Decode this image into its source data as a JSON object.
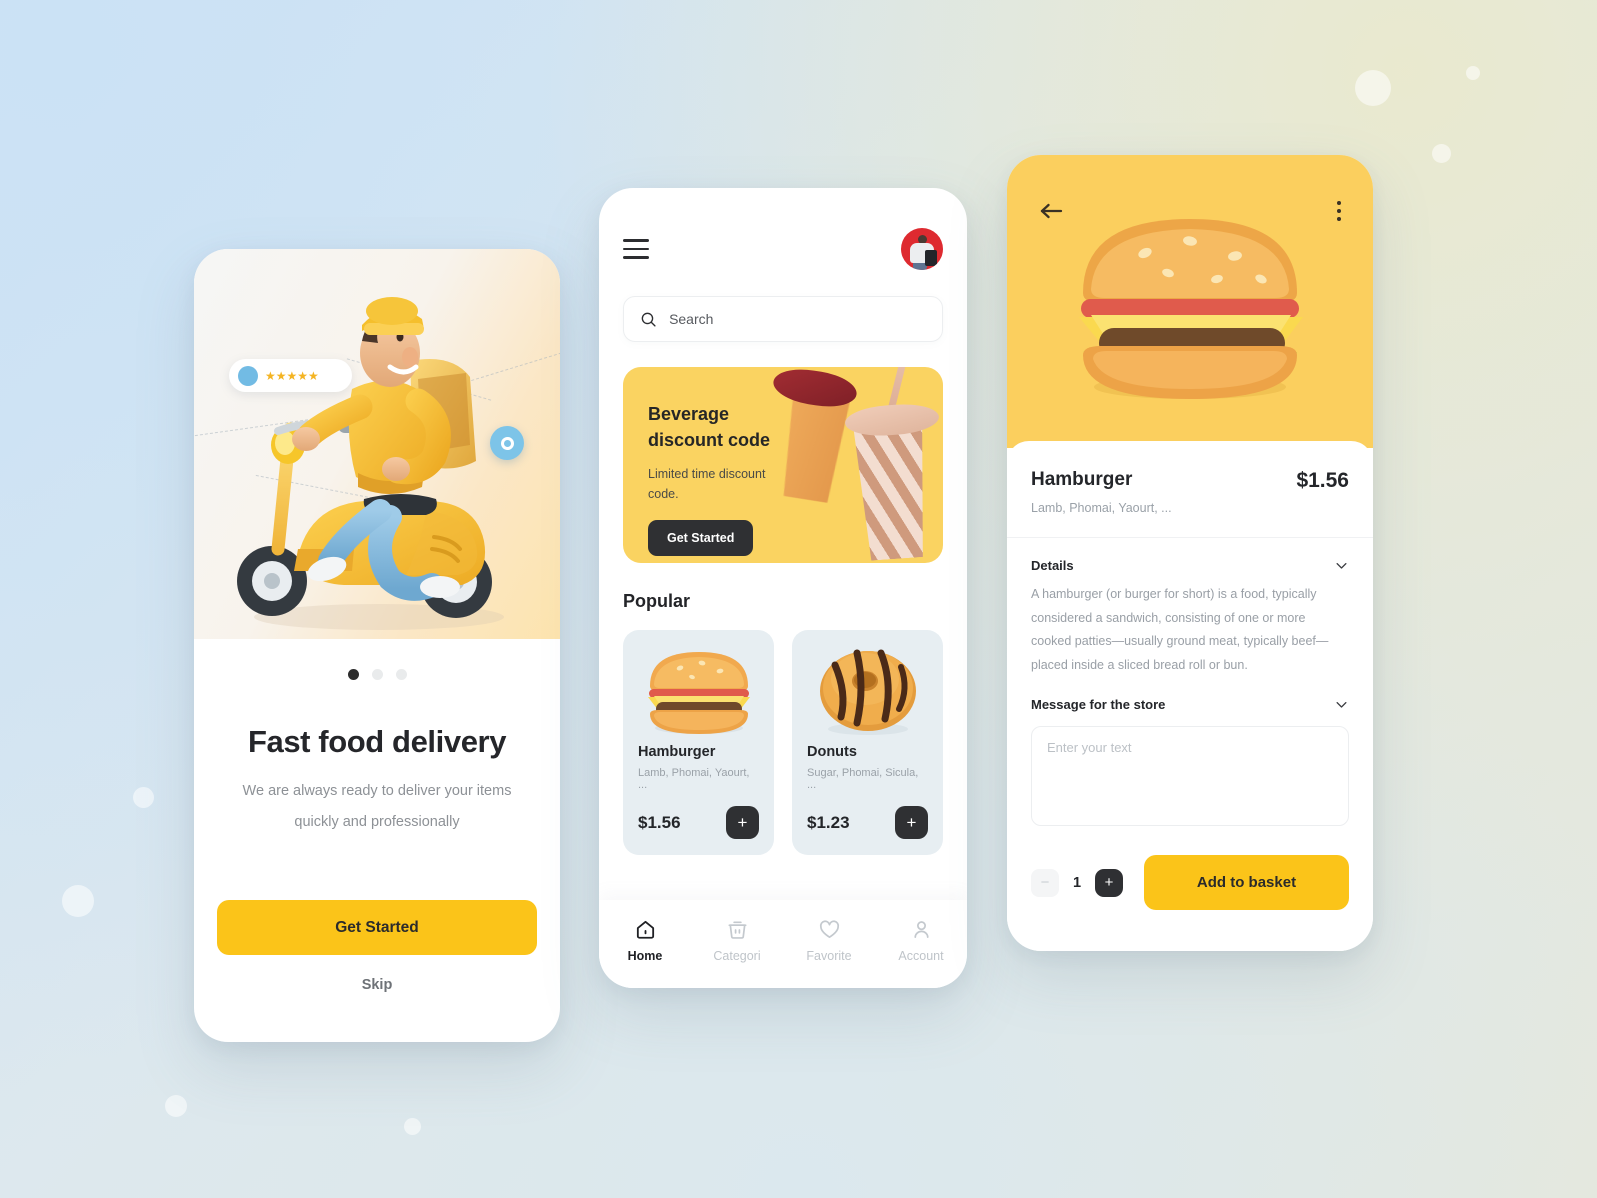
{
  "theme": {
    "accent_yellow": "#fbc419",
    "banner_yellow": "#fad361",
    "hero_yellow": "#fbcf5e",
    "dark": "#2f3033",
    "card_bg": "#e7eef2",
    "muted_text": "#9aa1a8"
  },
  "onboarding": {
    "rating": {
      "stars": "★★★★★",
      "star_count": 5
    },
    "pin_icon": "location-pin-icon",
    "pagination": {
      "total": 3,
      "active_index": 0
    },
    "title": "Fast food delivery",
    "subtitle": "We are always ready to deliver your items quickly and professionally",
    "primary_button": "Get Started",
    "skip_button": "Skip"
  },
  "home": {
    "menu_icon": "hamburger-menu-icon",
    "avatar_icon": "user-avatar",
    "search": {
      "icon": "search-icon",
      "placeholder": "Search",
      "value": ""
    },
    "promo": {
      "title": "Beverage discount code",
      "subtitle": "Limited time discount code.",
      "button": "Get Started"
    },
    "popular": {
      "heading": "Popular",
      "items": [
        {
          "name": "Hamburger",
          "description": "Lamb, Phomai, Yaourt, ...",
          "price": "$1.56",
          "add_label": "+",
          "image": "hamburger-3d"
        },
        {
          "name": "Donuts",
          "description": "Sugar, Phomai, Sicula, ...",
          "price": "$1.23",
          "add_label": "+",
          "image": "donut-3d"
        }
      ]
    },
    "tabs": [
      {
        "label": "Home",
        "icon": "home-icon",
        "active": true
      },
      {
        "label": "Categori",
        "icon": "basket-icon",
        "active": false
      },
      {
        "label": "Favorite",
        "icon": "heart-icon",
        "active": false
      },
      {
        "label": "Account",
        "icon": "person-icon",
        "active": false
      }
    ]
  },
  "detail": {
    "back_icon": "arrow-left-icon",
    "more_icon": "kebab-menu-icon",
    "hero_image": "hamburger-3d",
    "name": "Hamburger",
    "ingredients": "Lamb, Phomai, Yaourt, ...",
    "price": "$1.56",
    "details": {
      "label": "Details",
      "chevron": "chevron-down-icon",
      "body": "A hamburger (or burger for short) is a food, typically considered a sandwich, consisting of one or more cooked patties—usually ground meat, typically beef—placed inside a sliced bread roll or bun."
    },
    "message": {
      "label": "Message for the store",
      "chevron": "chevron-down-icon",
      "placeholder": "Enter your text",
      "value": ""
    },
    "quantity": {
      "minus": "−",
      "value": "1",
      "plus": "+"
    },
    "add_button": "Add to basket"
  }
}
